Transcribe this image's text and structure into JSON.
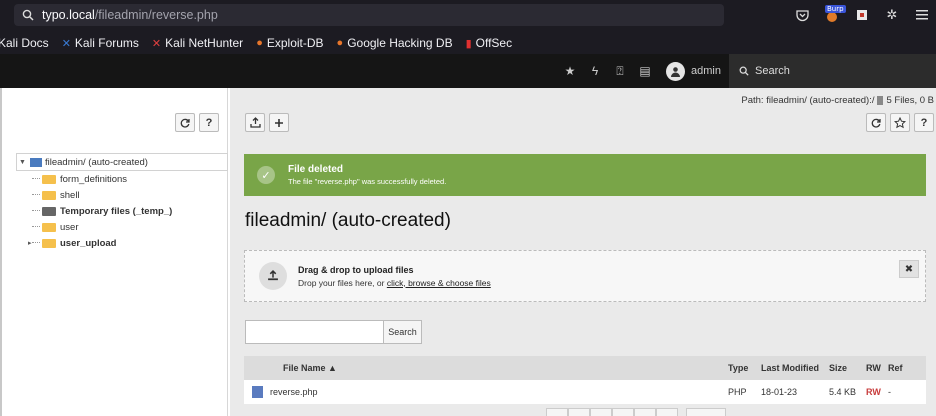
{
  "browser": {
    "url_host": "typo.local",
    "url_path": "/fileadmin/reverse.php",
    "burp_label": "Burp",
    "bookmarks": [
      {
        "label": "Kali Docs",
        "icon": "kali-dragon-icon"
      },
      {
        "label": "Kali Forums",
        "icon": "kali-icon"
      },
      {
        "label": "Kali NetHunter",
        "icon": "nethunter-icon"
      },
      {
        "label": "Exploit-DB",
        "icon": "exploitdb-icon"
      },
      {
        "label": "Google Hacking DB",
        "icon": "ghdb-icon"
      },
      {
        "label": "OffSec",
        "icon": "offsec-icon"
      }
    ]
  },
  "topbar": {
    "username": "admin",
    "search_label": "Search"
  },
  "tree": {
    "root": "fileadmin/ (auto-created)",
    "items": [
      {
        "label": "form_definitions",
        "bold": false
      },
      {
        "label": "shell",
        "bold": false
      },
      {
        "label": "Temporary files (_temp_)",
        "bold": true
      },
      {
        "label": "user",
        "bold": false
      },
      {
        "label": "user_upload",
        "bold": true
      }
    ]
  },
  "content": {
    "path": "Path: fileadmin/ (auto-created):/",
    "file_count": "5 Files, 0 B",
    "flash": {
      "title": "File deleted",
      "message": "The file \"reverse.php\" was successfully deleted.",
      "color": "#79a548"
    },
    "heading": "fileadmin/ (auto-created)",
    "dropzone": {
      "title": "Drag & drop to upload files",
      "prefix": "Drop your files here, or ",
      "link": "click, browse & choose files"
    },
    "search_button": "Search",
    "search_placeholder": ""
  },
  "table": {
    "headers": {
      "name": "File Name ▲",
      "type": "Type",
      "modified": "Last Modified",
      "size": "Size",
      "rw": "RW",
      "ref": "Ref"
    },
    "rows": [
      {
        "name": "reverse.php",
        "type": "PHP",
        "modified": "18-01-23",
        "size": "5.4 KB",
        "rw": "RW",
        "ref": "-"
      }
    ]
  },
  "help_label": "?"
}
